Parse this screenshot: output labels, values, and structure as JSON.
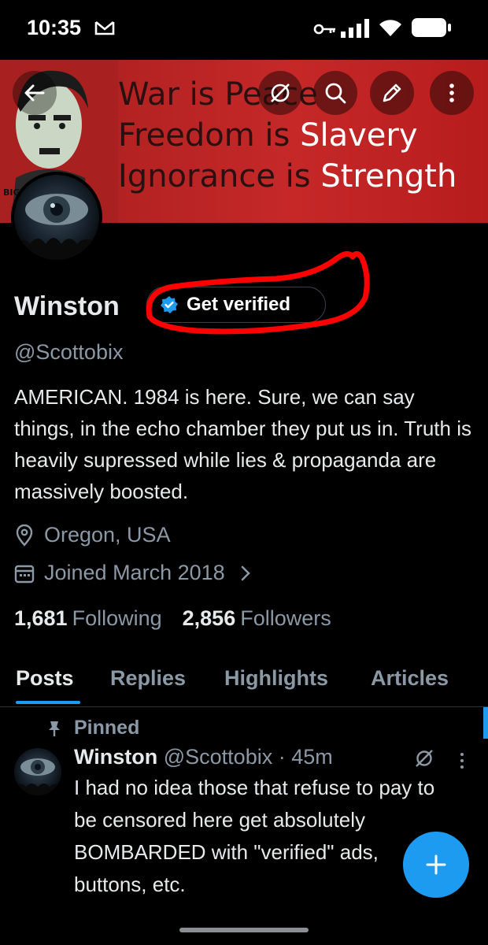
{
  "status_bar": {
    "time": "10:35"
  },
  "banner": {
    "lines": [
      {
        "dark": "War is ",
        "white": "",
        "rest": "Peace"
      },
      {
        "dark": "Freedom is ",
        "white": "Slavery"
      },
      {
        "dark": "Ignorance is ",
        "white": "Strength"
      }
    ],
    "line1": "War is Peace",
    "line2_a": "Freedom is ",
    "line2_b": "Slavery",
    "line3_a": "Ignorance is ",
    "line3_b": "Strength",
    "small_text": "BIG"
  },
  "profile": {
    "name": "Winston",
    "verify_label": "Get verified",
    "handle": "@Scottobix",
    "bio": "AMERICAN. 1984 is here. Sure, we can say things, in the echo chamber they put us in. Truth is heavily supressed while lies & propaganda are massively boosted.",
    "location": "Oregon, USA",
    "joined": "Joined March 2018",
    "following_count": "1,681",
    "following_label": "Following",
    "followers_count": "2,856",
    "followers_label": "Followers"
  },
  "tabs": [
    "Posts",
    "Replies",
    "Highlights",
    "Articles"
  ],
  "tweet": {
    "pinned_label": "Pinned",
    "name": "Winston",
    "handle_time": "@Scottobix · 45m",
    "text": "I had no idea those that refuse to pay to be censored here get absolutely BOMBARDED with \"verified\" ads, buttons, etc."
  },
  "colors": {
    "accent": "#1d9bf0",
    "banner_red": "#c62828",
    "scribble_red": "#ff0000",
    "muted": "#8b98a5"
  },
  "icons": [
    "back-arrow-icon",
    "grok-icon",
    "search-icon",
    "edit-icon",
    "more-icon",
    "verified-badge-icon",
    "location-icon",
    "calendar-icon",
    "chevron-right-icon",
    "pin-icon",
    "plus-icon"
  ]
}
